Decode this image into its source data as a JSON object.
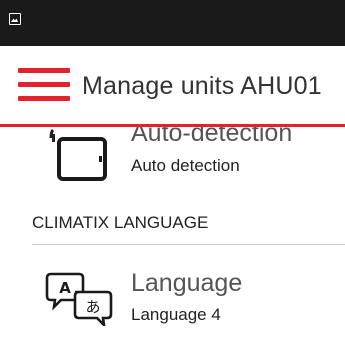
{
  "status_bar": {
    "icon": "image-icon"
  },
  "app_bar": {
    "menu_icon": "hamburger-menu-icon",
    "title": "Manage units AHU01",
    "accent_color": "#e3222b"
  },
  "list": {
    "auto_detection": {
      "icon": "tablet-icon",
      "title": "Auto-detection",
      "subtitle": "Auto detection"
    },
    "section_header": "CLIMATIX LANGUAGE",
    "language": {
      "icon": "translate-speech-bubbles-icon",
      "title": "Language",
      "subtitle": "Language 4"
    }
  }
}
